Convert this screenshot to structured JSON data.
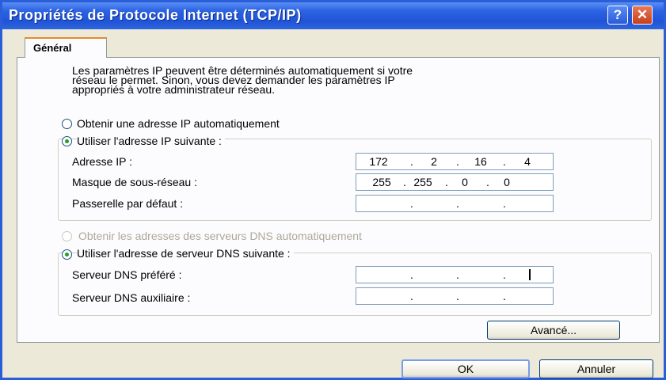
{
  "window": {
    "title": "Propriétés de Protocole Internet (TCP/IP)",
    "help_label": "?",
    "close_label": "✕"
  },
  "tab": {
    "label": "Général"
  },
  "description": [
    "Les paramètres IP peuvent être déterminés automatiquement si votre",
    "réseau le permet. Sinon, vous devez demander les paramètres IP",
    "appropriés à votre administrateur réseau."
  ],
  "ip_section": {
    "auto_option": "Obtenir une adresse IP automatiquement",
    "manual_option": "Utiliser l'adresse IP suivante :",
    "selected": "manual",
    "fields": [
      {
        "label": "Adresse IP :",
        "octets": [
          "172",
          "2",
          "16",
          "4"
        ]
      },
      {
        "label": "Masque de sous-réseau :",
        "octets": [
          "255",
          "255",
          "0",
          "0"
        ]
      },
      {
        "label": "Passerelle par défaut :",
        "octets": [
          "",
          "",
          "",
          ""
        ]
      }
    ]
  },
  "dns_section": {
    "auto_option": "Obtenir les adresses des serveurs DNS automatiquement",
    "manual_option": "Utiliser l'adresse de serveur DNS suivante :",
    "selected": "manual",
    "fields": [
      {
        "label": "Serveur DNS préféré :",
        "octets": [
          "",
          "",
          "",
          ""
        ]
      },
      {
        "label": "Serveur DNS auxiliaire :",
        "octets": [
          "",
          "",
          "",
          ""
        ]
      }
    ]
  },
  "buttons": {
    "advanced": "Avancé...",
    "ok": "OK",
    "cancel": "Annuler"
  },
  "colors": {
    "titlebar": "#2d64e3",
    "dialog_bg": "#ece9d8",
    "tab_accent": "#e68b2c",
    "radio_dot": "#21a121"
  }
}
